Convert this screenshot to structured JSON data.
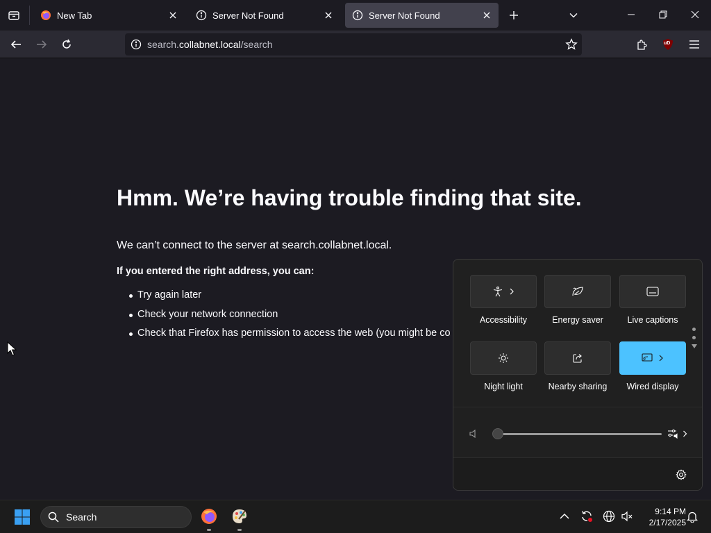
{
  "browser": {
    "tabs": [
      {
        "label": "New Tab",
        "icon": "firefox-icon",
        "selected": false
      },
      {
        "label": "Server Not Found",
        "icon": "info-icon",
        "selected": false
      },
      {
        "label": "Server Not Found",
        "icon": "info-icon",
        "selected": true
      }
    ],
    "url": {
      "prefix": "search.",
      "host": "collabnet.local",
      "path": "/search"
    },
    "extension_badge": "uD"
  },
  "error_page": {
    "title": "Hmm. We’re having trouble finding that site.",
    "description": "We can’t connect to the server at search.collabnet.local.",
    "subheading": "If you entered the right address, you can:",
    "items": [
      "Try again later",
      "Check your network connection",
      "Check that Firefox has permission to access the web (you might be co"
    ]
  },
  "quick_settings": {
    "tiles": [
      {
        "label": "Accessibility",
        "icon": "accessibility-icon",
        "has_chevron": true,
        "active": false
      },
      {
        "label": "Energy saver",
        "icon": "leaf-icon",
        "has_chevron": false,
        "active": false
      },
      {
        "label": "Live captions",
        "icon": "captions-icon",
        "has_chevron": false,
        "active": false
      },
      {
        "label": "Night light",
        "icon": "brightness-icon",
        "has_chevron": false,
        "active": false
      },
      {
        "label": "Nearby sharing",
        "icon": "share-icon",
        "has_chevron": false,
        "active": false
      },
      {
        "label": "Wired display",
        "icon": "cast-icon",
        "has_chevron": true,
        "active": true
      }
    ],
    "volume_level": 0,
    "accent_color": "#4cc2ff"
  },
  "taskbar": {
    "search_placeholder": "Search",
    "time": "9:14 PM",
    "date": "2/17/2025"
  },
  "colors": {
    "page_bg": "#1c1b22",
    "toolbar_bg": "#2b2a33",
    "selected_tab_bg": "#42414d",
    "taskbar_bg": "#1c1c1c"
  }
}
